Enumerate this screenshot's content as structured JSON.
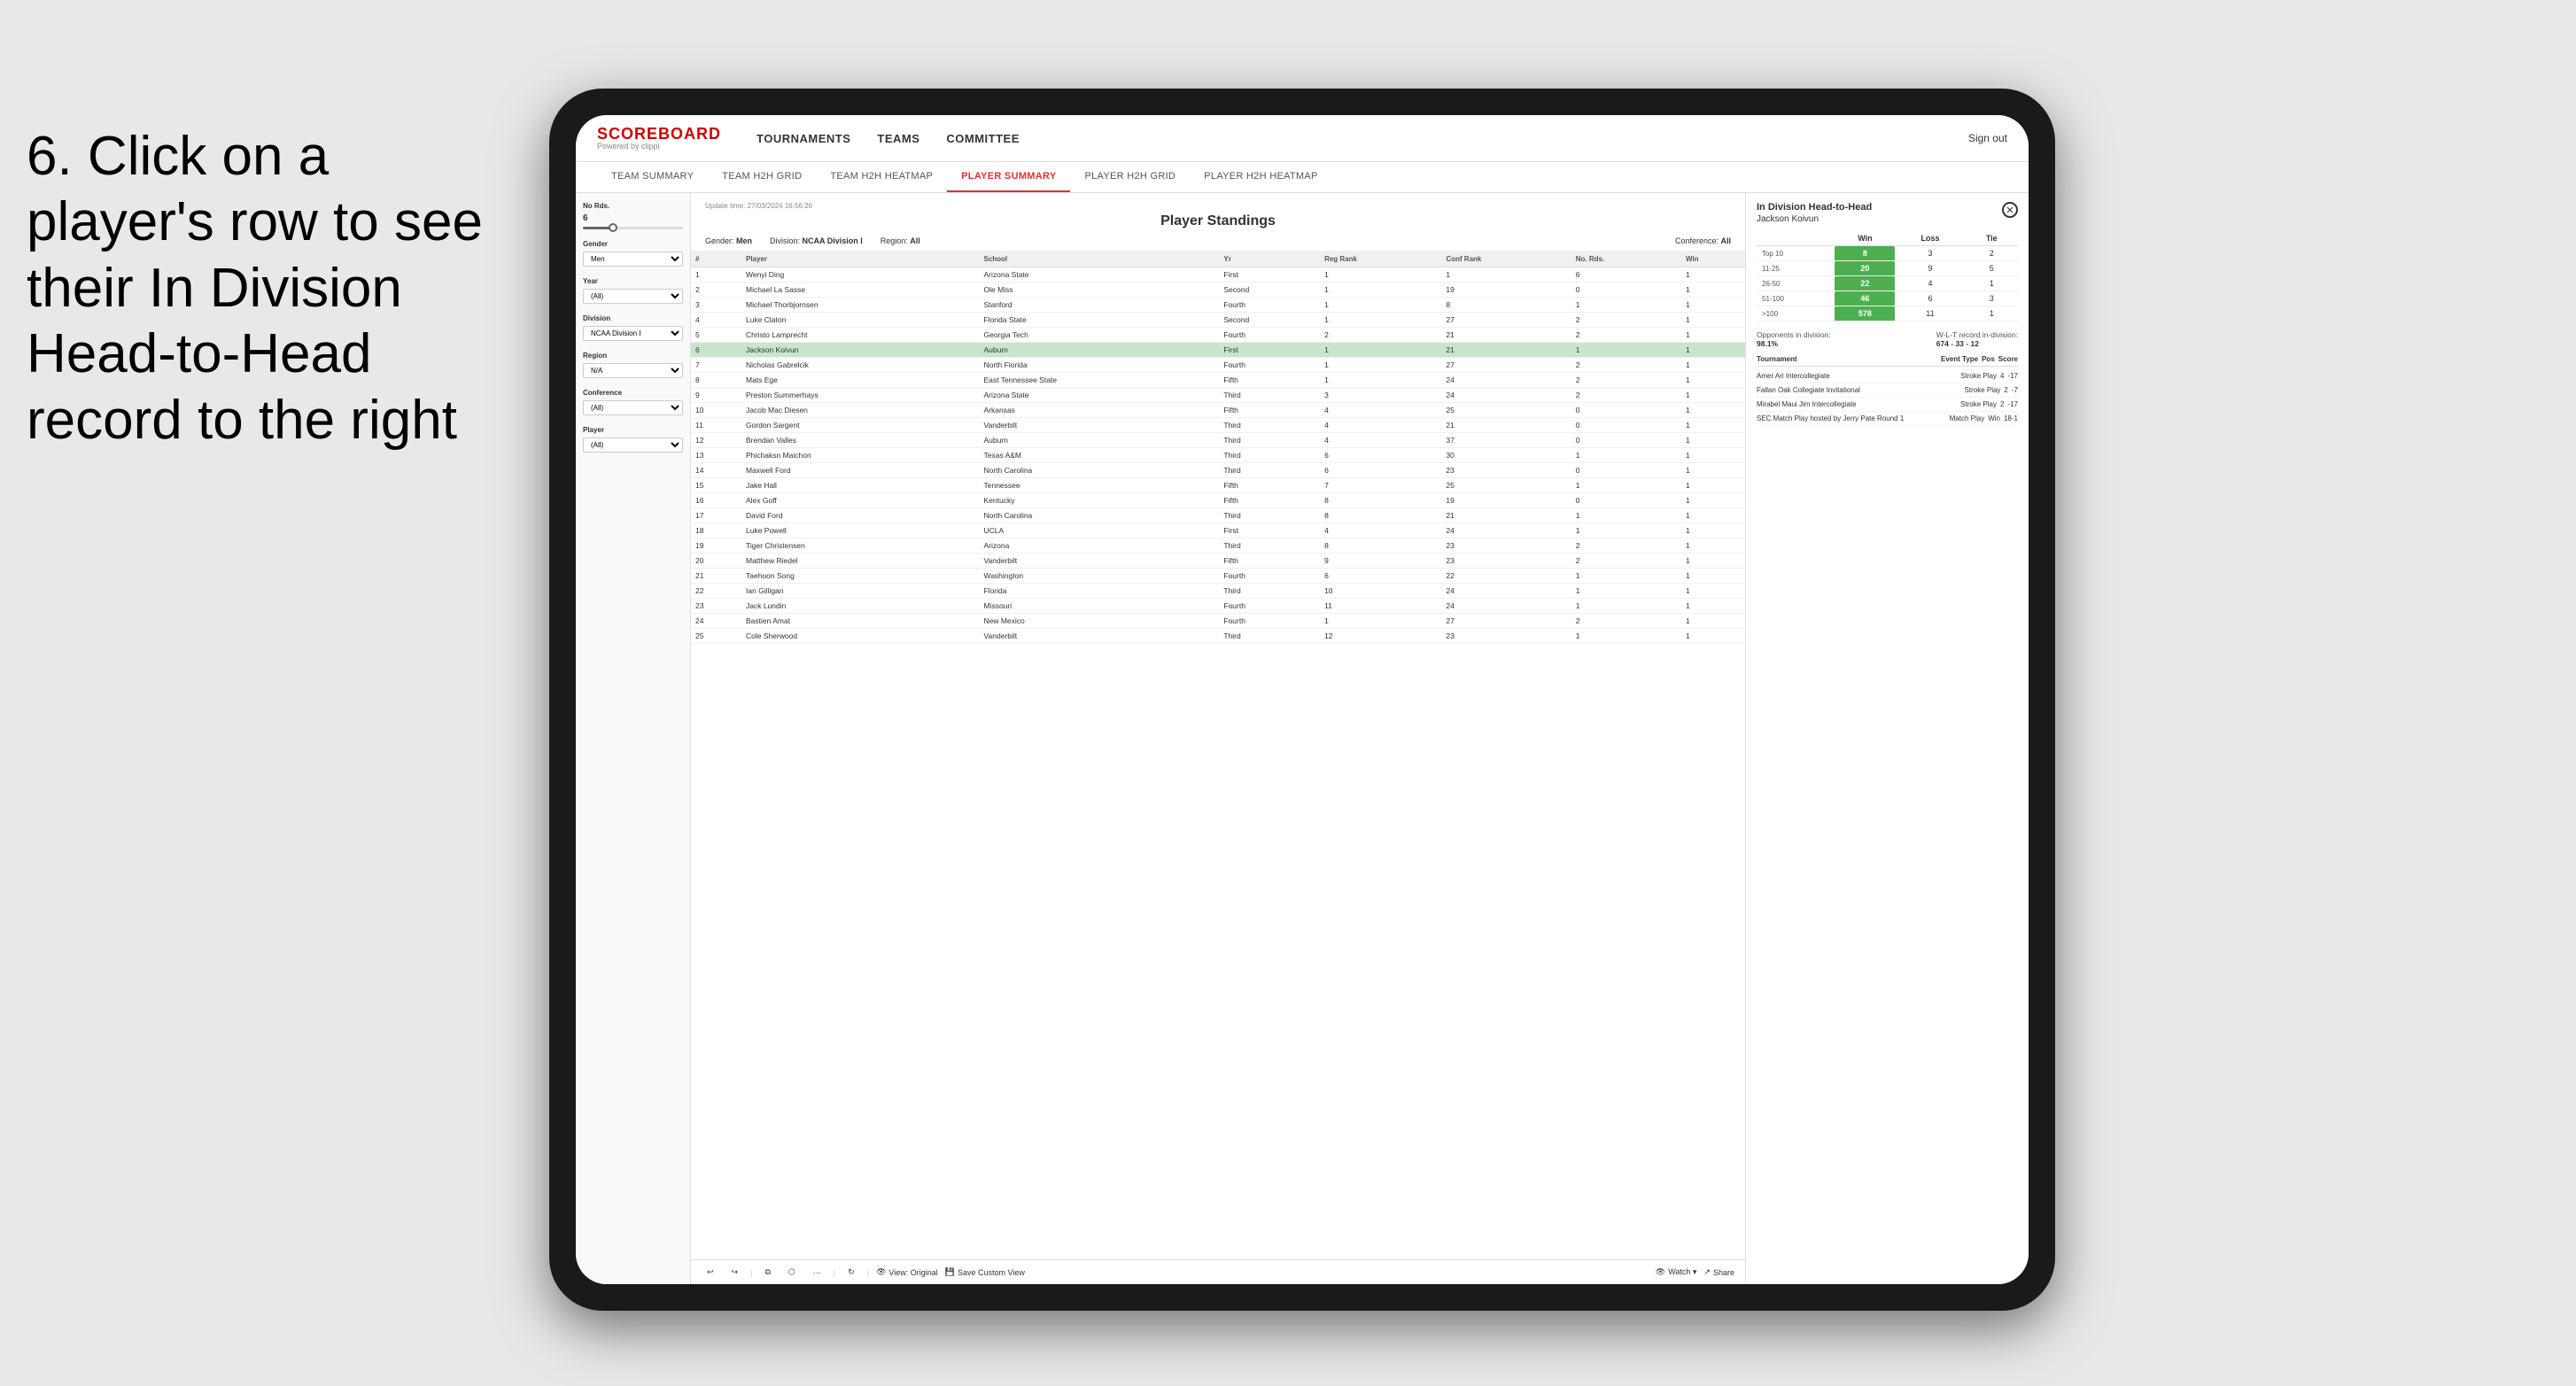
{
  "instruction": {
    "text": "6. Click on a player's row to see their In Division Head-to-Head record to the right"
  },
  "nav": {
    "logo": "SCOREBOARD",
    "logo_sub": "Powered by clippi",
    "items": [
      "TOURNAMENTS",
      "TEAMS",
      "COMMITTEE"
    ],
    "sign_out": "Sign out"
  },
  "sub_nav": {
    "items": [
      "TEAM SUMMARY",
      "TEAM H2H GRID",
      "TEAM H2H HEATMAP",
      "PLAYER SUMMARY",
      "PLAYER H2H GRID",
      "PLAYER H2H HEATMAP"
    ],
    "active": "PLAYER SUMMARY"
  },
  "filters": {
    "no_rds_label": "No Rds.",
    "no_rds_value": "6",
    "gender_label": "Gender",
    "gender_value": "Men",
    "year_label": "Year",
    "year_value": "(All)",
    "division_label": "Division",
    "division_value": "NCAA Division I",
    "region_label": "Region",
    "region_value": "N/A",
    "conference_label": "Conference",
    "conference_value": "(All)",
    "player_label": "Player",
    "player_value": "(All)"
  },
  "panel": {
    "update_time": "Update time:",
    "update_value": "27/03/2024 16:56:26",
    "title": "Player Standings",
    "gender": "Men",
    "division": "NCAA Division I",
    "region": "All",
    "conference": "All"
  },
  "table": {
    "headers": [
      "#",
      "Player",
      "School",
      "Yr",
      "Reg Rank",
      "Conf Rank",
      "No. Rds.",
      "Win"
    ],
    "rows": [
      {
        "rank": 1,
        "player": "Wenyi Ding",
        "school": "Arizona State",
        "yr": "First",
        "reg_rank": 1,
        "conf_rank": 1,
        "no_rds": 6,
        "win": 1,
        "selected": false
      },
      {
        "rank": 2,
        "player": "Michael La Sasse",
        "school": "Ole Miss",
        "yr": "Second",
        "reg_rank": 1,
        "conf_rank": 19,
        "no_rds": 0,
        "win": 1,
        "selected": false
      },
      {
        "rank": 3,
        "player": "Michael Thorbjornsen",
        "school": "Stanford",
        "yr": "Fourth",
        "reg_rank": 1,
        "conf_rank": 8,
        "no_rds": 1,
        "win": 1,
        "selected": false
      },
      {
        "rank": 4,
        "player": "Luke Claton",
        "school": "Florida State",
        "yr": "Second",
        "reg_rank": 1,
        "conf_rank": 27,
        "no_rds": 2,
        "win": 1,
        "selected": false
      },
      {
        "rank": 5,
        "player": "Christo Lamprecht",
        "school": "Georgia Tech",
        "yr": "Fourth",
        "reg_rank": 2,
        "conf_rank": 21,
        "no_rds": 2,
        "win": 1,
        "selected": false
      },
      {
        "rank": 6,
        "player": "Jackson Koivun",
        "school": "Auburn",
        "yr": "First",
        "reg_rank": 1,
        "conf_rank": 21,
        "no_rds": 1,
        "win": 1,
        "selected": true
      },
      {
        "rank": 7,
        "player": "Nicholas Gabrelcik",
        "school": "North Florida",
        "yr": "Fourth",
        "reg_rank": 1,
        "conf_rank": 27,
        "no_rds": 2,
        "win": 1,
        "selected": false
      },
      {
        "rank": 8,
        "player": "Mats Ege",
        "school": "East Tennessee State",
        "yr": "Fifth",
        "reg_rank": 1,
        "conf_rank": 24,
        "no_rds": 2,
        "win": 1,
        "selected": false
      },
      {
        "rank": 9,
        "player": "Preston Summerhays",
        "school": "Arizona State",
        "yr": "Third",
        "reg_rank": 3,
        "conf_rank": 24,
        "no_rds": 2,
        "win": 1,
        "selected": false
      },
      {
        "rank": 10,
        "player": "Jacob Mac Diesen",
        "school": "Arkansas",
        "yr": "Fifth",
        "reg_rank": 4,
        "conf_rank": 25,
        "no_rds": 0,
        "win": 1,
        "selected": false
      },
      {
        "rank": 11,
        "player": "Gordon Sargent",
        "school": "Vanderbilt",
        "yr": "Third",
        "reg_rank": 4,
        "conf_rank": 21,
        "no_rds": 0,
        "win": 1,
        "selected": false
      },
      {
        "rank": 12,
        "player": "Brendan Valles",
        "school": "Auburn",
        "yr": "Third",
        "reg_rank": 4,
        "conf_rank": 37,
        "no_rds": 0,
        "win": 1,
        "selected": false
      },
      {
        "rank": 13,
        "player": "Phichaksn Maichon",
        "school": "Texas A&M",
        "yr": "Third",
        "reg_rank": 6,
        "conf_rank": 30,
        "no_rds": 1,
        "win": 1,
        "selected": false
      },
      {
        "rank": 14,
        "player": "Maxwell Ford",
        "school": "North Carolina",
        "yr": "Third",
        "reg_rank": 6,
        "conf_rank": 23,
        "no_rds": 0,
        "win": 1,
        "selected": false
      },
      {
        "rank": 15,
        "player": "Jake Hall",
        "school": "Tennessee",
        "yr": "Fifth",
        "reg_rank": 7,
        "conf_rank": 25,
        "no_rds": 1,
        "win": 1,
        "selected": false
      },
      {
        "rank": 16,
        "player": "Alex Goff",
        "school": "Kentucky",
        "yr": "Fifth",
        "reg_rank": 8,
        "conf_rank": 19,
        "no_rds": 0,
        "win": 1,
        "selected": false
      },
      {
        "rank": 17,
        "player": "David Ford",
        "school": "North Carolina",
        "yr": "Third",
        "reg_rank": 8,
        "conf_rank": 21,
        "no_rds": 1,
        "win": 1,
        "selected": false
      },
      {
        "rank": 18,
        "player": "Luke Powell",
        "school": "UCLA",
        "yr": "First",
        "reg_rank": 4,
        "conf_rank": 24,
        "no_rds": 1,
        "win": 1,
        "selected": false
      },
      {
        "rank": 19,
        "player": "Tiger Christensen",
        "school": "Arizona",
        "yr": "Third",
        "reg_rank": 8,
        "conf_rank": 23,
        "no_rds": 2,
        "win": 1,
        "selected": false
      },
      {
        "rank": 20,
        "player": "Matthew Riedel",
        "school": "Vanderbilt",
        "yr": "Fifth",
        "reg_rank": 9,
        "conf_rank": 23,
        "no_rds": 2,
        "win": 1,
        "selected": false
      },
      {
        "rank": 21,
        "player": "Taehoon Song",
        "school": "Washington",
        "yr": "Fourth",
        "reg_rank": 6,
        "conf_rank": 22,
        "no_rds": 1,
        "win": 1,
        "selected": false
      },
      {
        "rank": 22,
        "player": "Ian Gilligan",
        "school": "Florida",
        "yr": "Third",
        "reg_rank": 10,
        "conf_rank": 24,
        "no_rds": 1,
        "win": 1,
        "selected": false
      },
      {
        "rank": 23,
        "player": "Jack Lundin",
        "school": "Missouri",
        "yr": "Fourth",
        "reg_rank": 11,
        "conf_rank": 24,
        "no_rds": 1,
        "win": 1,
        "selected": false
      },
      {
        "rank": 24,
        "player": "Bastien Amat",
        "school": "New Mexico",
        "yr": "Fourth",
        "reg_rank": 1,
        "conf_rank": 27,
        "no_rds": 2,
        "win": 1,
        "selected": false
      },
      {
        "rank": 25,
        "player": "Cole Sherwood",
        "school": "Vanderbilt",
        "yr": "Third",
        "reg_rank": 12,
        "conf_rank": 23,
        "no_rds": 1,
        "win": 1,
        "selected": false
      }
    ]
  },
  "toolbar": {
    "view_original": "View: Original",
    "save_custom": "Save Custom View",
    "watch": "Watch ▾",
    "share": "Share"
  },
  "h2h": {
    "title": "In Division Head-to-Head",
    "player": "Jackson Koivun",
    "col_headers": [
      "Win",
      "Loss",
      "Tie"
    ],
    "rows": [
      {
        "label": "Top 10",
        "win": 8,
        "loss": 3,
        "tie": 2
      },
      {
        "label": "11-25",
        "win": 20,
        "loss": 9,
        "tie": 5
      },
      {
        "label": "26-50",
        "win": 22,
        "loss": 4,
        "tie": 1
      },
      {
        "label": "51-100",
        "win": 46,
        "loss": 6,
        "tie": 3
      },
      {
        "label": ">100",
        "win": 578,
        "loss": 11,
        "tie": 1
      }
    ],
    "opponents_label": "Opponents in division:",
    "opponents_value": "98.1%",
    "record_label": "W-L-T record in-division:",
    "record_value": "674 - 33 - 12",
    "tournament_headers": [
      "Tournament",
      "Event Type",
      "Pos",
      "Score"
    ],
    "tournaments": [
      {
        "name": "Amer Ari Intercollegiate",
        "type": "Stroke Play",
        "pos": 4,
        "score": -17
      },
      {
        "name": "Fallan Oak Collegiate Invitational",
        "type": "Stroke Play",
        "pos": 2,
        "score": -7
      },
      {
        "name": "Mirabel Maui Jim Intercollegiate",
        "type": "Stroke Play",
        "pos": 2,
        "score": -17
      },
      {
        "name": "SEC Match Play hosted by Jerry Pate Round 1",
        "type": "Match Play",
        "pos": "Win",
        "score": "18-1"
      }
    ]
  }
}
